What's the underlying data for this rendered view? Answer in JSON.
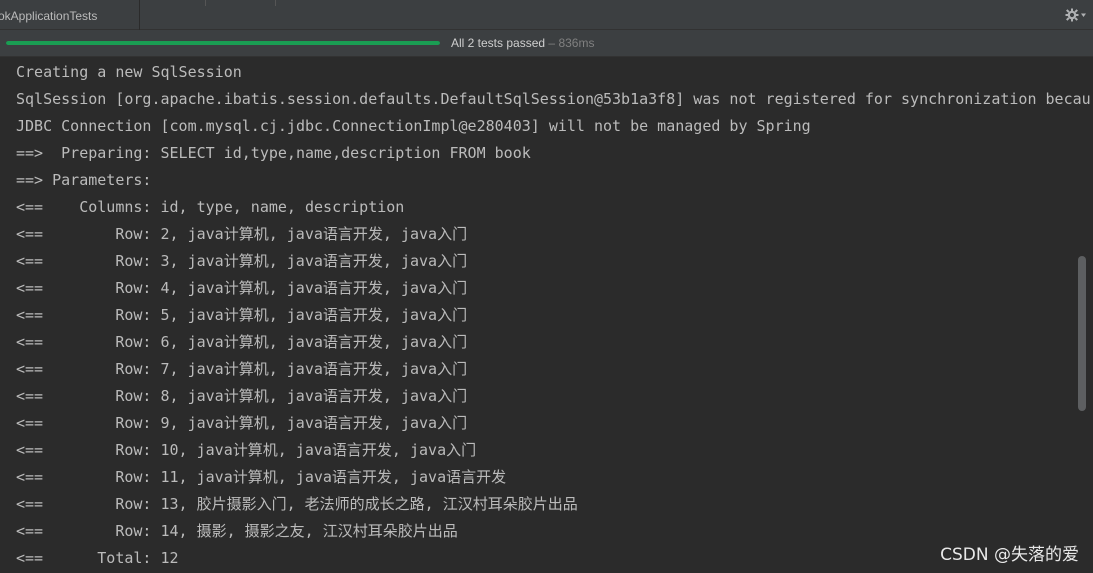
{
  "tab": {
    "label": "okApplicationTests"
  },
  "toolbar": {
    "settings_icon": "gear-icon"
  },
  "test_status": {
    "summary": "All 2 tests passed",
    "separator": "–",
    "duration": "836ms",
    "progress_fraction": 1.0,
    "progress_color": "#1a9d53"
  },
  "console": {
    "lines": [
      "Creating a new SqlSession",
      "SqlSession [org.apache.ibatis.session.defaults.DefaultSqlSession@53b1a3f8] was not registered for synchronization becau",
      "JDBC Connection [com.mysql.cj.jdbc.ConnectionImpl@e280403] will not be managed by Spring",
      "==>  Preparing: SELECT id,type,name,description FROM book",
      "==> Parameters: ",
      "<==    Columns: id, type, name, description",
      "<==        Row: 2, java计算机, java语言开发, java入门",
      "<==        Row: 3, java计算机, java语言开发, java入门",
      "<==        Row: 4, java计算机, java语言开发, java入门",
      "<==        Row: 5, java计算机, java语言开发, java入门",
      "<==        Row: 6, java计算机, java语言开发, java入门",
      "<==        Row: 7, java计算机, java语言开发, java入门",
      "<==        Row: 8, java计算机, java语言开发, java入门",
      "<==        Row: 9, java计算机, java语言开发, java入门",
      "<==        Row: 10, java计算机, java语言开发, java入门",
      "<==        Row: 11, java计算机, java语言开发, java语言开发",
      "<==        Row: 13, 胶片摄影入门, 老法师的成长之路, 江汉村耳朵胶片出品",
      "<==        Row: 14, 摄影, 摄影之友, 江汉村耳朵胶片出品",
      "<==      Total: 12"
    ],
    "scroll_position": 0.55,
    "scroll_visible_fraction": 0.3
  },
  "watermark": "CSDN @失落的爱"
}
